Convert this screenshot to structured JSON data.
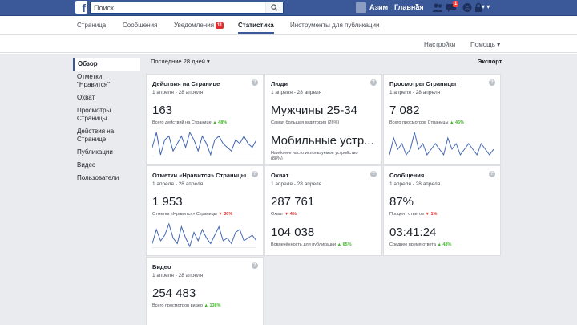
{
  "topbar": {
    "logo": "f",
    "search_placeholder": "Поиск",
    "user_name": "Азим",
    "home_label": "Главная"
  },
  "page_tabs": [
    {
      "label": "Страница"
    },
    {
      "label": "Сообщения"
    },
    {
      "label": "Уведомления",
      "badge": "11"
    },
    {
      "label": "Статистика"
    },
    {
      "label": "Инструменты для публикации"
    }
  ],
  "secondary_nav": {
    "settings_label": "Настройки",
    "help_label": "Помощь ▾"
  },
  "sidebar": {
    "items": [
      {
        "label": "Обзор"
      },
      {
        "label": "Отметки \"Нравится\""
      },
      {
        "label": "Охват"
      },
      {
        "label": "Просмотры Страницы"
      },
      {
        "label": "Действия на Страницe"
      },
      {
        "label": "Публикации"
      },
      {
        "label": "Видео"
      },
      {
        "label": "Пользователи"
      }
    ]
  },
  "toolbar": {
    "period_label": "Последние 28 дней ▾",
    "export_label": "Экспорт"
  },
  "cards": [
    {
      "title": "Действия на Странице",
      "date": "1 апреля - 28 апреля",
      "value": "163",
      "sub_text": "Всего действий на Странице",
      "change": "▲ 48%",
      "trend": "up",
      "spark": [
        9,
        13,
        7,
        11,
        12,
        8,
        10,
        12,
        9,
        13,
        11,
        8,
        12,
        10,
        7,
        11,
        12,
        10,
        9,
        8,
        11,
        10,
        12,
        10,
        9,
        11
      ]
    },
    {
      "title": "Люди",
      "date": "1 апреля - 28 апреля",
      "value": "Мужчины 25-34",
      "sub_text": "Самая большая аудитория (26%)",
      "value2": "Мобильные устр...",
      "sub_text2": "Наиболее часто используемое устройство",
      "sub_text2b": "(88%)"
    },
    {
      "title": "Просмотры Страницы",
      "date": "1 апреля - 28 апреля",
      "value": "7 082",
      "sub_text": "Всего просмотров Страницы",
      "change": "▲ 46%",
      "trend": "up",
      "spark": [
        6,
        9,
        7,
        8,
        6,
        7,
        10,
        7,
        8,
        6,
        7,
        8,
        7,
        6,
        9,
        7,
        8,
        6,
        7,
        8,
        7,
        6,
        8,
        7,
        6,
        7
      ]
    },
    {
      "title": "Отметки «Нравится» Страницы",
      "date": "1 апреля - 28 апреля",
      "value": "1 953",
      "sub_text": "Отметки «Нравится» Страницы",
      "change": "▼ 30%",
      "trend": "down",
      "spark": [
        8,
        13,
        9,
        11,
        15,
        10,
        8,
        14,
        10,
        7,
        12,
        9,
        13,
        10,
        8,
        11,
        14,
        9,
        10,
        8,
        12,
        13,
        9,
        10,
        11,
        9
      ]
    },
    {
      "title": "Охват",
      "date": "1 апреля - 28 апреля",
      "value": "287 761",
      "sub_text": "Охват",
      "change": "▼ 4%",
      "trend": "down",
      "value2": "104 038",
      "sub_text2": "Вовлечённость для публикации",
      "change2": "▲ 65%",
      "trend2": "up"
    },
    {
      "title": "Сообщения",
      "date": "1 апреля - 28 апреля",
      "value": "87%",
      "sub_text": "Процент ответов",
      "change": "▼ 1%",
      "trend": "down",
      "value2": "03:41:24",
      "sub_text2": "Среднее время ответа",
      "change2": "▲ 48%",
      "trend2": "up"
    },
    {
      "title": "Видео",
      "date": "1 апреля - 28 апреля",
      "value": "254 483",
      "sub_text": "Всего просмотров видео",
      "change": "▲ 138%",
      "trend": "up"
    }
  ]
}
